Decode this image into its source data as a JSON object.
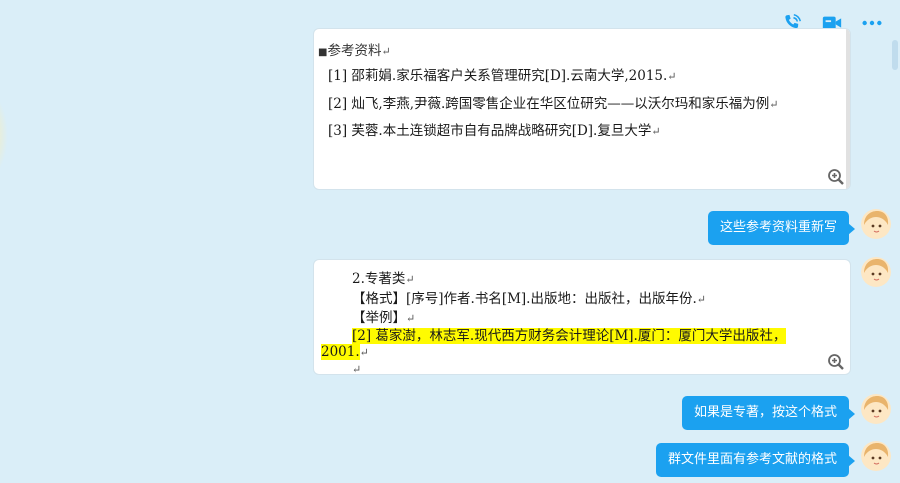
{
  "toolbar": {
    "icons": [
      "phone-call-icon",
      "video-call-icon",
      "more-icon"
    ],
    "accent_color": "#1ba1f0"
  },
  "doc1": {
    "heading": "参考资料",
    "items": [
      "[1]  邵莉娟.家乐福客户关系管理研究[D].云南大学,2015.",
      "[2]  灿飞,李燕,尹薇.跨国零售企业在华区位研究——以沃尔玛和家乐福为例",
      "[3]  芙蓉.本土连锁超市自有品牌战略研究[D].复旦大学"
    ]
  },
  "doc2": {
    "title": "2.专著类",
    "format": "【格式】[序号]作者.书名[M].出版地：出版社，出版年份.",
    "example_label": "【举例】",
    "example_line1": "[2]  葛家澍，林志军.现代西方财务会计理论[M].厦门：厦门大学出版社，",
    "example_line2": "2001."
  },
  "messages": [
    "这些参考资料重新写",
    "如果是专著，按这个格式",
    "群文件里面有参考文献的格式"
  ],
  "para_mark": "↵",
  "bubble_color": "#1ba1f0",
  "highlight_color": "#fffb00"
}
